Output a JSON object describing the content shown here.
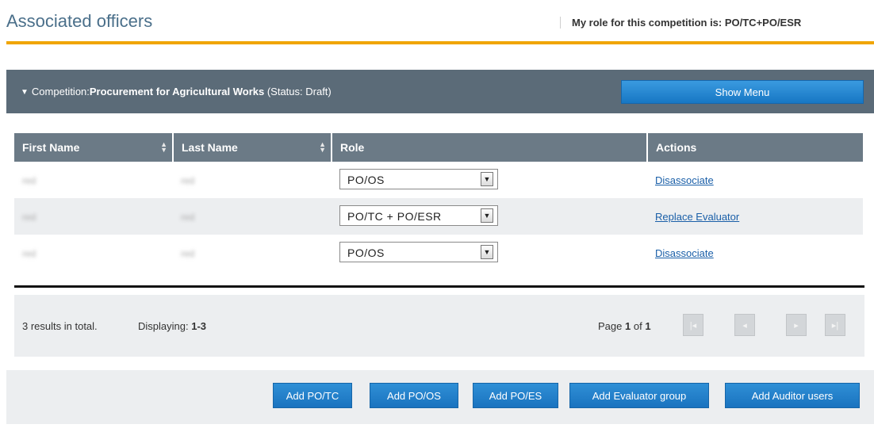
{
  "header": {
    "title": "Associated officers",
    "role_info": "My role for this competition is: PO/TC+PO/ESR"
  },
  "competition": {
    "prefix": "Competition:",
    "name": "Procurement for Agricultural Works",
    "status": "(Status: Draft)",
    "show_menu_label": "Show Menu"
  },
  "table": {
    "columns": [
      "First Name",
      "Last Name",
      "Role",
      "Actions"
    ],
    "rows": [
      {
        "first_name": "red",
        "last_name": "red",
        "role": "PO/OS",
        "action": "Disassociate"
      },
      {
        "first_name": "red",
        "last_name": "red",
        "role": "PO/TC + PO/ESR",
        "action": "Replace Evaluator"
      },
      {
        "first_name": "red",
        "last_name": "red",
        "role": "PO/OS",
        "action": "Disassociate"
      }
    ]
  },
  "pager": {
    "summary": "3 results in total.",
    "displaying_label": "Displaying:",
    "displaying_range": "1-3",
    "page_label": "Page",
    "page_current": "1",
    "page_of": "of",
    "page_total": "1",
    "first_icon": "first-page-icon",
    "prev_icon": "prev-page-icon",
    "next_icon": "next-page-icon",
    "last_icon": "last-page-icon"
  },
  "buttons": {
    "add_potc": "Add PO/TC",
    "add_poos": "Add PO/OS",
    "add_poes": "Add PO/ES",
    "add_evaluator_group": "Add Evaluator group",
    "add_auditor_users": "Add Auditor users"
  },
  "colors": {
    "title": "#4a6f8a",
    "accent_rule": "#f0a500",
    "competition_bar": "#5b6b78",
    "header_row": "#6b7a86",
    "button_blue": "#1a73bf",
    "link": "#1a5fa8"
  }
}
